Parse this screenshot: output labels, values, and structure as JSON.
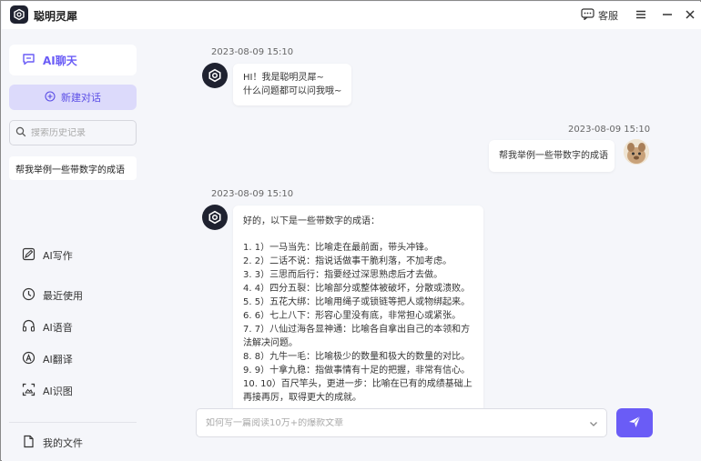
{
  "app": {
    "title": "聪明灵犀",
    "accent_color": "#6a5cf6",
    "logo_icon": "lingxi-logo-icon"
  },
  "titlebar": {
    "service_label": "客服",
    "service_icon": "chat-bubble-icon",
    "menu_icon": "hamburger-icon",
    "minimize_icon": "minus-icon",
    "close_icon": "close-icon"
  },
  "sidebar": {
    "chat_label": "AI聊天",
    "new_chat_label": "新建对话",
    "search_placeholder": "搜索历史记录",
    "history": [
      {
        "label": "帮我举例一些带数字的成语"
      }
    ],
    "tools": [
      {
        "label": "AI写作",
        "icon": "write-icon"
      },
      {
        "label": "最近使用",
        "icon": "clock-icon"
      },
      {
        "label": "AI语音",
        "icon": "voice-icon"
      },
      {
        "label": "AI翻译",
        "icon": "translate-icon"
      },
      {
        "label": "AI识图",
        "icon": "image-recognize-icon"
      }
    ],
    "files_label": "我的文件"
  },
  "chat": {
    "messages": [
      {
        "role": "bot",
        "time": "2023-08-09 15:10",
        "lines": [
          "HI！我是聪明灵犀~",
          "什么问题都可以问我哦~"
        ]
      },
      {
        "role": "user",
        "time": "2023-08-09 15:10",
        "lines": [
          "帮我举例一些带数字的成语"
        ]
      },
      {
        "role": "bot",
        "time": "2023-08-09 15:10",
        "intro": "好的，以下是一些带数字的成语：",
        "items": [
          "1. 1）一马当先：比喻走在最前面，带头冲锋。",
          "2. 2）二话不说：指说话做事干脆利落，不加考虑。",
          "3. 3）三思而后行：指要经过深思熟虑后才去做。",
          "4. 4）四分五裂：比喻部分或整体被破坏，分散或溃败。",
          "5. 5）五花大绑：比喻用绳子或锁链等把人或物绑起来。",
          "6. 6）七上八下：形容心里没有底，非常担心或紧张。",
          "7. 7）八仙过海各显神通：比喻各自拿出自己的本领和方法解决问题。",
          "8. 8）九牛一毛：比喻极少的数量和极大的数量的对比。",
          "9. 9）十拿九稳：指做事情有十足的把握，非常有信心。",
          "10. 10）百尺竿头，更进一步：比喻在已有的成绩基础上再接再厉，取得更大的成就。"
        ]
      }
    ]
  },
  "composer": {
    "placeholder": "如何写一篇阅读10万+的爆款文章",
    "send_icon": "send-icon",
    "expand_icon": "chevron-down-icon"
  }
}
